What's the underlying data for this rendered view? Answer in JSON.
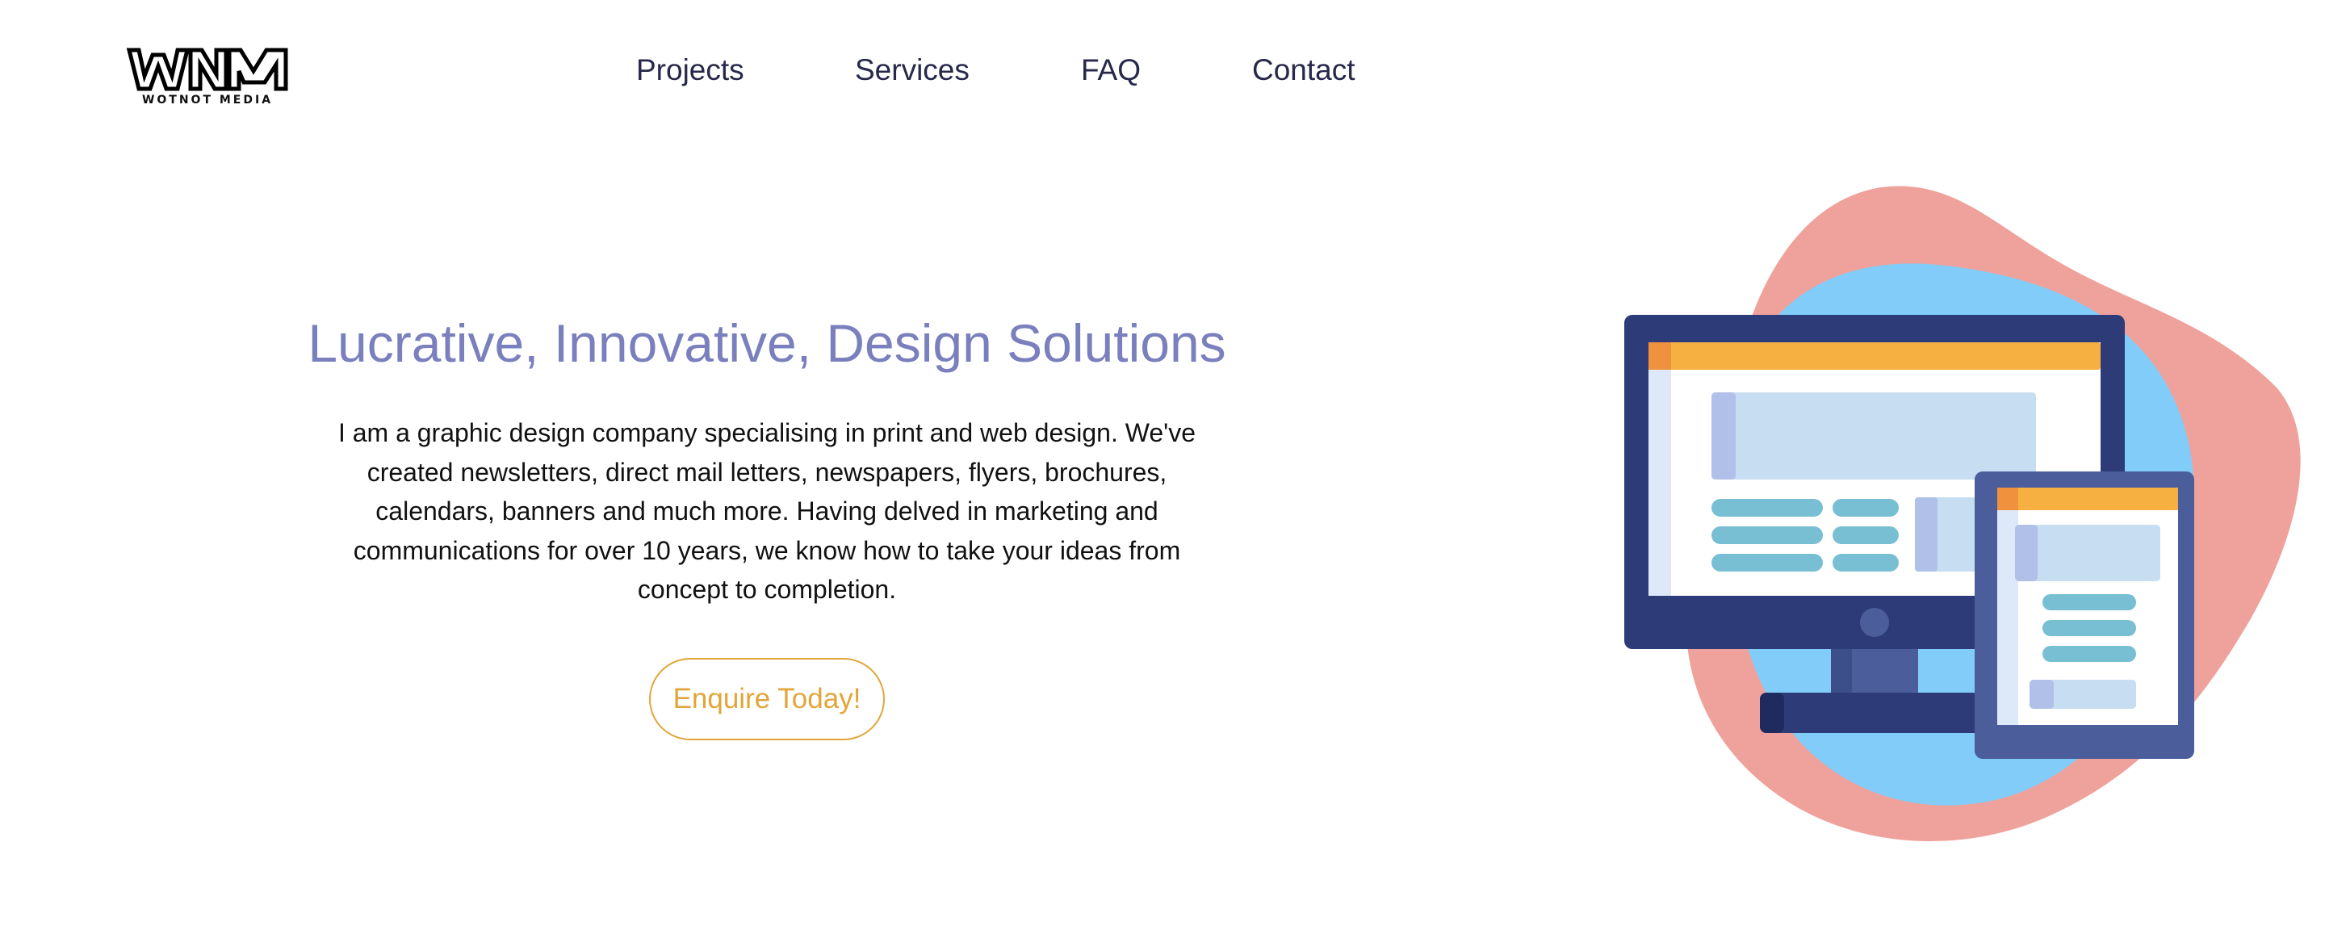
{
  "header": {
    "logo": {
      "mark": "WNM",
      "subtitle": "WOTNOT MEDIA"
    },
    "nav": [
      {
        "label": "Projects"
      },
      {
        "label": "Services"
      },
      {
        "label": "FAQ"
      },
      {
        "label": "Contact"
      }
    ]
  },
  "hero": {
    "title": "Lucrative, Innovative, Design Solutions",
    "description": "I am a graphic design company specialising in print and web design. We've created newsletters, direct mail letters, newspapers, flyers, brochures, calendars, banners and much more. Having delved in marketing and communications for over 10 years, we know how to take your ideas from concept to completion.",
    "cta_label": "Enquire Today!"
  },
  "colors": {
    "title": "#7a7fbd",
    "nav_text": "#27284a",
    "body_text": "#111111",
    "cta_accent": "#e2a53a",
    "blob_pink": "#efa29c",
    "blob_blue": "#82ccf9",
    "monitor_navy": "#2d3c78",
    "window_bar": "#f6b042",
    "content_light_blue": "#c6ddf2",
    "line_teal": "#78bfd4"
  },
  "icons": {
    "illustration": "responsive-web-design-illustration"
  }
}
